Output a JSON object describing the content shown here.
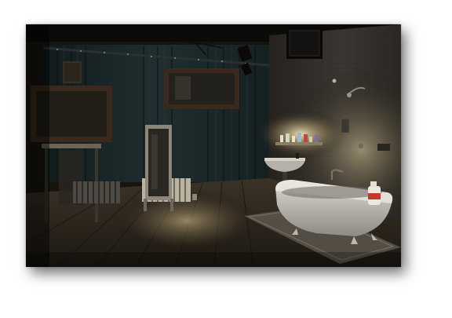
{
  "photo": {
    "subject": "dimly-lit-bathroom-set",
    "palette": {
      "shadow": "#0c0a07",
      "wall_tile": "#4a4640",
      "spotlight": "#e8d6a6",
      "tub_white": "#d8d6cf",
      "curtain": "#1d2a2b",
      "floor": "#3a3125",
      "bottle_red": "#c23a2a",
      "mirror_frame": "#3b2a1c"
    }
  }
}
